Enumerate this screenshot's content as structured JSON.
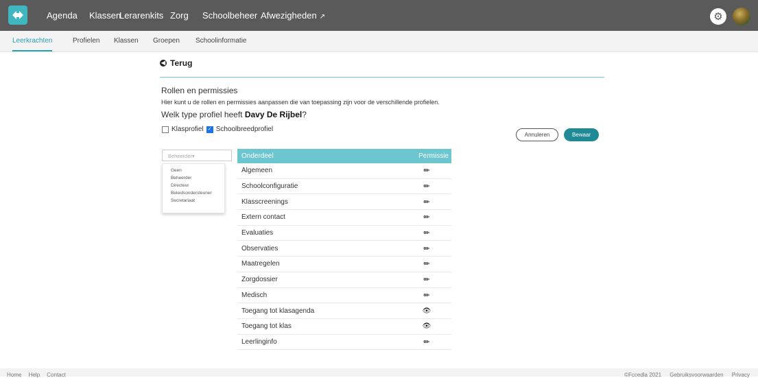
{
  "colors": {
    "topbar": "#5a5a5a",
    "accent": "#6cc6cf",
    "save_button": "#1f8a96",
    "checkbox_checked": "#1a73e8"
  },
  "topnav": {
    "items": [
      {
        "label": "Agenda"
      },
      {
        "label": "Klassen"
      },
      {
        "label": "Lerarenkits"
      },
      {
        "label": "Zorg"
      },
      {
        "label": "Schoolbeheer"
      },
      {
        "label": "Afwezigheden"
      }
    ],
    "icons": [
      "logo-icon",
      "external-link-icon",
      "gear-icon",
      "avatar"
    ]
  },
  "subnav": {
    "items": [
      {
        "label": "Leerkrachten",
        "active": true
      },
      {
        "label": "Profielen"
      },
      {
        "label": "Klassen"
      },
      {
        "label": "Groepen"
      },
      {
        "label": "Schoolinformatie"
      }
    ]
  },
  "page": {
    "back_label": "Terug",
    "title": "Rollen en permissies",
    "description": "Hier kunt u de rollen en permissies aanpassen die van toepassing zijn voor de verschillende profielen.",
    "question_prefix": "Welk type profiel heeft ",
    "question_name": "Davy De Rijbel",
    "question_suffix": "?",
    "checkbox_klasprofiel": {
      "label": "Klasprofiel",
      "checked": false
    },
    "checkbox_schoolbreed": {
      "label": "Schoolbreedprofiel",
      "checked": true
    },
    "cancel_label": "Annuleren",
    "save_label": "Bewaar"
  },
  "role_select": {
    "value": "Beheerder",
    "options": [
      "Geen",
      "Beheerder",
      "Directeur",
      "Beleidsondersteuner",
      "Secretariaat"
    ]
  },
  "table": {
    "headers": [
      "Onderdeel",
      "Permissie"
    ],
    "rows": [
      {
        "label": "Algemeen",
        "permission": "pencil-icon"
      },
      {
        "label": "Schoolconfiguratie",
        "permission": "pencil-icon"
      },
      {
        "label": "Klasscreenings",
        "permission": "pencil-icon"
      },
      {
        "label": "Extern contact",
        "permission": "pencil-icon"
      },
      {
        "label": "Evaluaties",
        "permission": "pencil-icon"
      },
      {
        "label": "Observaties",
        "permission": "pencil-icon"
      },
      {
        "label": "Maatregelen",
        "permission": "pencil-icon"
      },
      {
        "label": "Zorgdossier",
        "permission": "pencil-icon"
      },
      {
        "label": "Medisch",
        "permission": "pencil-icon"
      },
      {
        "label": "Toegang tot klasagenda",
        "permission": "eye-icon"
      },
      {
        "label": "Toegang tot klas",
        "permission": "eye-icon"
      },
      {
        "label": "Leerlinginfo",
        "permission": "pencil-icon"
      }
    ]
  },
  "footer": {
    "left": [
      "Home",
      "Help",
      "Contact"
    ],
    "right": [
      "©Fccedla 2021",
      "Gebruiksvoorwaarden",
      "Privacy"
    ]
  }
}
